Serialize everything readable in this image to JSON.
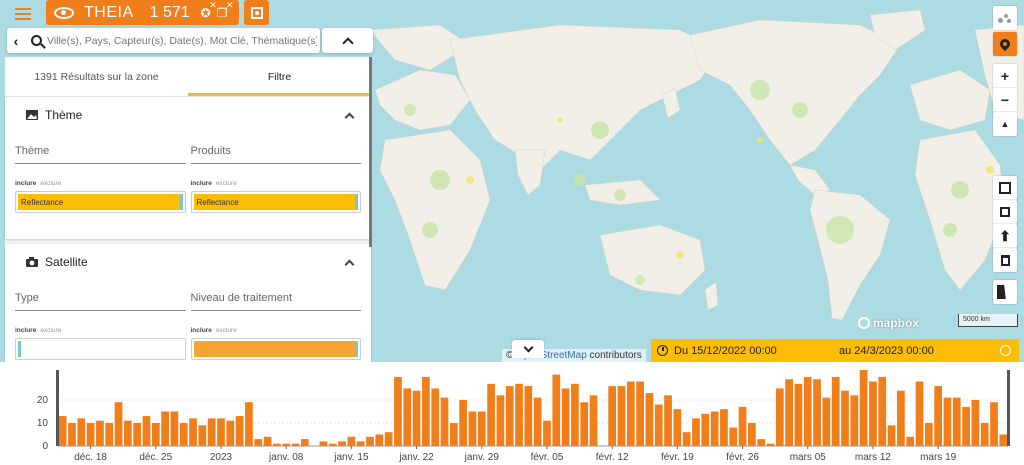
{
  "header": {
    "brand": "THEIA",
    "count": "1 571",
    "accent": "#f07f1b"
  },
  "search": {
    "placeholder": "Ville(s), Pays, Capteur(s), Date(s), Mot Clé, Thématique(s)"
  },
  "panel": {
    "tabs": [
      {
        "label": "1391 Résultats sur la zone"
      },
      {
        "label": "Filtre"
      }
    ],
    "theme_section": {
      "title": "Thème",
      "field1": "Thème",
      "field2": "Produits",
      "include": "inclure",
      "exclude": "exclure",
      "chip1": "Reflectance",
      "chip2": "Reflectance"
    },
    "satellite_section": {
      "title": "Satellite",
      "field1": "Type",
      "field2": "Niveau de traitement",
      "include": "inclure",
      "exclude": "exclure"
    }
  },
  "map": {
    "scale": "5000 km",
    "attribution_prefix": "©",
    "attribution_link": "OpenStreetMap",
    "attribution_suffix": "contributors",
    "mapbox": "mapbox"
  },
  "datebar": {
    "from": "Du  15/12/2022 00:00",
    "to": "au  24/3/2023 00:00"
  },
  "chart_data": {
    "type": "bar",
    "color": "#f07f1b",
    "ylim": [
      0,
      33
    ],
    "yticks": [
      0,
      10,
      20
    ],
    "xticks": [
      {
        "label": "déc. 18",
        "index": 3
      },
      {
        "label": "déc. 25",
        "index": 10
      },
      {
        "label": "2023",
        "index": 17
      },
      {
        "label": "janv. 08",
        "index": 24
      },
      {
        "label": "janv. 15",
        "index": 31
      },
      {
        "label": "janv. 22",
        "index": 38
      },
      {
        "label": "janv. 29",
        "index": 45
      },
      {
        "label": "févr. 05",
        "index": 52
      },
      {
        "label": "févr. 12",
        "index": 59
      },
      {
        "label": "févr. 19",
        "index": 66
      },
      {
        "label": "févr. 26",
        "index": 73
      },
      {
        "label": "mars 05",
        "index": 80
      },
      {
        "label": "mars 12",
        "index": 87
      },
      {
        "label": "mars 19",
        "index": 94
      }
    ],
    "values": [
      13,
      10,
      12,
      10,
      11,
      10,
      19,
      11,
      10,
      13,
      10,
      15,
      15,
      10,
      12,
      9,
      12,
      12,
      11,
      13,
      19,
      3,
      4,
      1,
      1,
      1,
      3,
      0,
      2,
      1,
      2,
      4,
      2,
      4,
      5,
      6,
      30,
      25,
      24,
      30,
      25,
      21,
      10,
      20,
      15,
      15,
      27,
      22,
      26,
      27,
      26,
      21,
      11,
      31,
      25,
      27,
      19,
      22,
      0,
      26,
      26,
      28,
      28,
      23,
      18,
      22,
      16,
      6,
      12,
      14,
      15,
      16,
      8,
      17,
      10,
      3,
      1,
      25,
      29,
      27,
      30,
      29,
      21,
      30,
      24,
      22,
      33,
      28,
      30,
      9,
      24,
      4,
      28,
      10,
      26,
      21,
      21,
      17,
      20,
      10,
      19,
      5
    ]
  }
}
